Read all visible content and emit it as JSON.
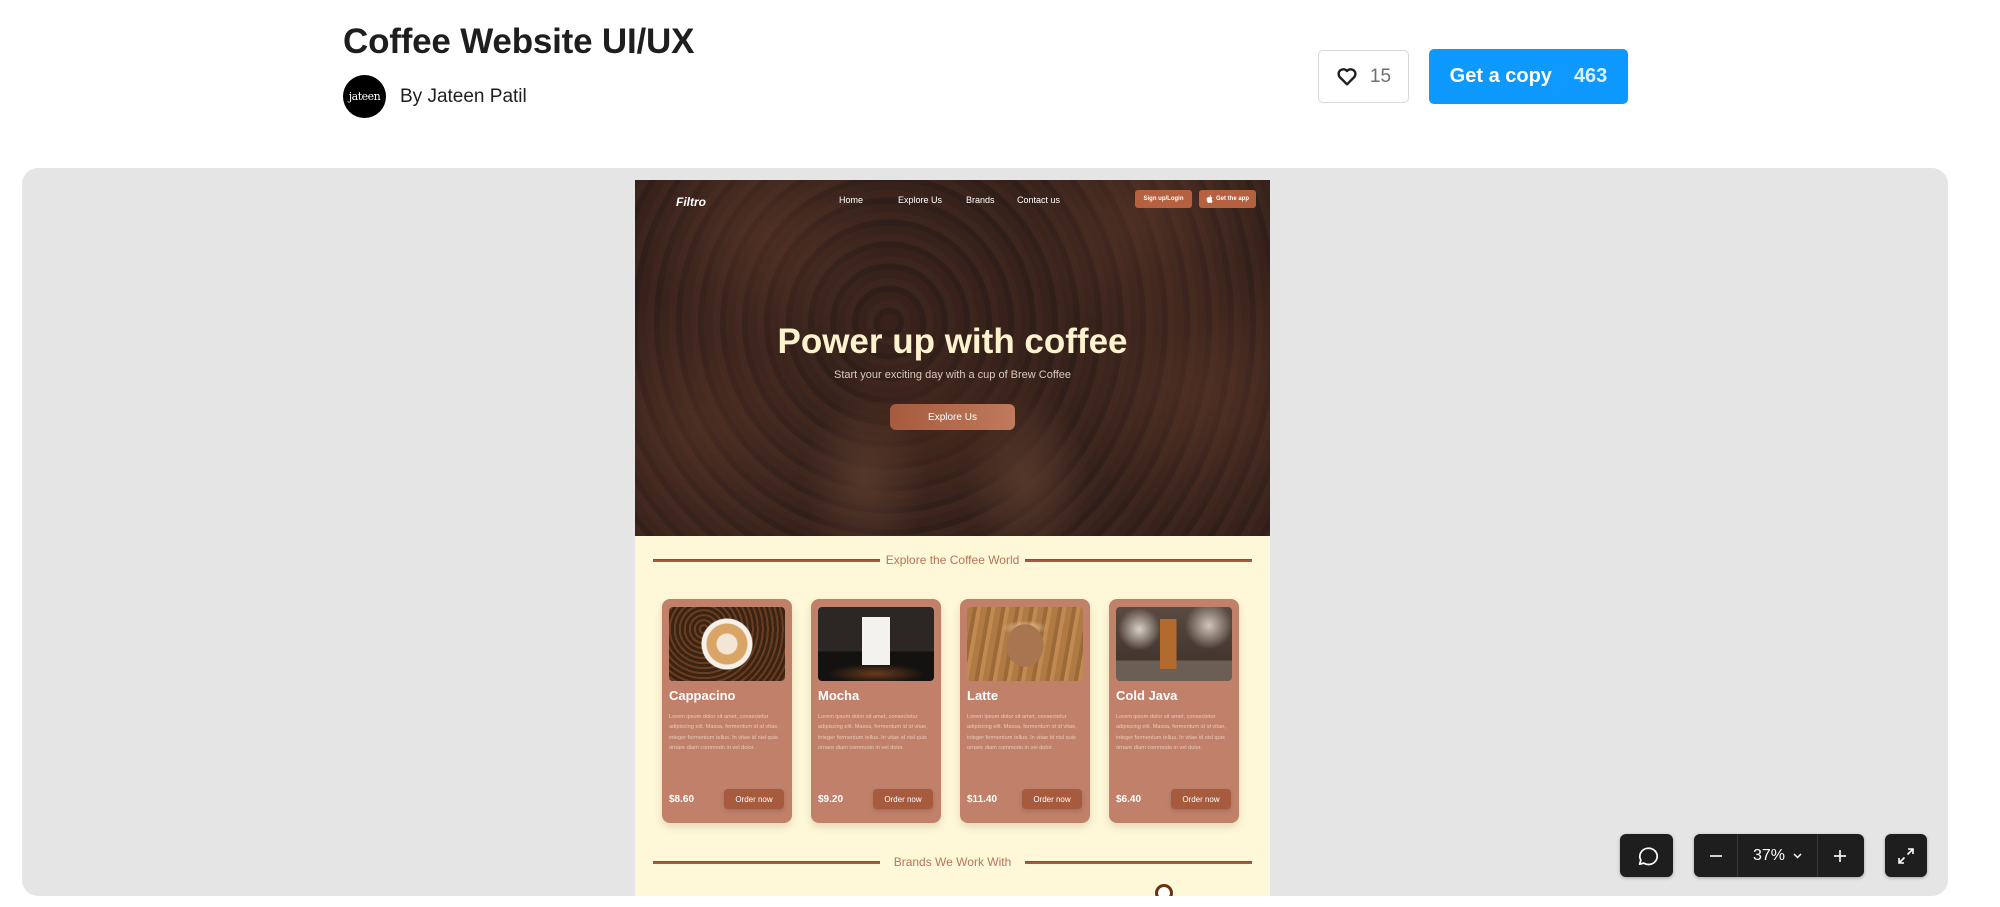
{
  "header": {
    "title": "Coffee Website UI/UX",
    "author_avatar_text": "jateen",
    "author": "By Jateen Patil",
    "like_icon": "heart-icon",
    "like_count": "15",
    "copy_label": "Get a copy",
    "copy_count": "463",
    "accent_color": "#0d99ff"
  },
  "design": {
    "nav": {
      "logo": "Filtro",
      "links": [
        "Home",
        "Explore Us",
        "Brands",
        "Contact us"
      ],
      "signup_label": "Sign up/Login",
      "app_label": "Get the app",
      "app_icon": "apple-icon"
    },
    "hero": {
      "title": "Power up with coffee",
      "subtitle": "Start your exciting day with a cup of Brew Coffee",
      "cta": "Explore Us"
    },
    "explore_heading": "Explore the Coffee World",
    "brands_heading": "Brands We Work With",
    "cards": [
      {
        "name": "Cappacino",
        "desc": "Lorem ipsum dolor sit amet, consectetur adipiscing elit. Massa, fermentum id id vitae, integer fermentum tellus. In vitae id nisl quis ornare diam commodo in vel dolor.",
        "price": "$8.60",
        "button": "Order now"
      },
      {
        "name": "Mocha",
        "desc": "Lorem ipsum dolor sit amet, consectetur adipiscing elit. Massa, fermentum id id vitae, integer fermentum tellus. In vitae id nisl quis ornare diam commodo in vel dolor.",
        "price": "$9.20",
        "button": "Order now"
      },
      {
        "name": "Latte",
        "desc": "Lorem ipsum dolor sit amet, consectetur adipiscing elit. Massa, fermentum id id vitae, integer fermentum tellus. In vitae id nisl quis ornare diam commodo in vel dolor.",
        "price": "$11.40",
        "button": "Order now"
      },
      {
        "name": "Cold Java",
        "desc": "Lorem ipsum dolor sit amet, consectetur adipiscing elit. Massa, fermentum id id vitae, integer fermentum tellus. In vitae id nisl quis ornare diam commodo in vel dolor.",
        "price": "$6.40",
        "button": "Order now"
      }
    ],
    "colors": {
      "cream": "#fef8d8",
      "card": "#c0806a",
      "accent_brown": "#a65a3e",
      "hero_title": "#fef3cf"
    }
  },
  "controls": {
    "comment_icon": "comment-icon",
    "zoom_out_icon": "minus-icon",
    "zoom_level": "37%",
    "zoom_dropdown_icon": "chevron-down-icon",
    "zoom_in_icon": "plus-icon",
    "fullscreen_icon": "expand-icon"
  }
}
